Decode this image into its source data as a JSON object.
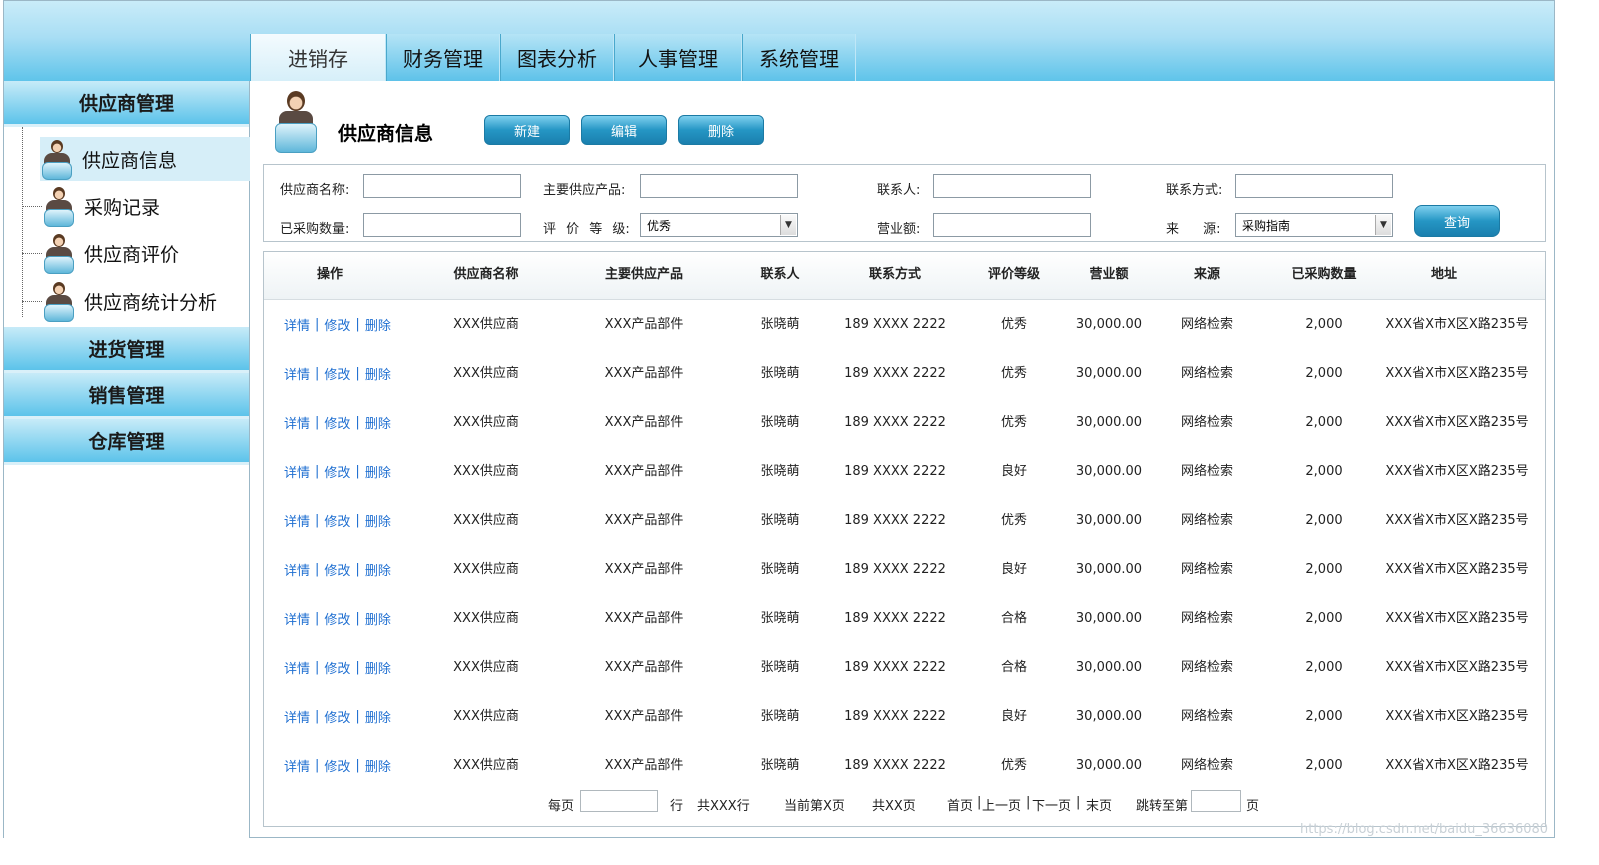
{
  "nav": {
    "tabs": [
      {
        "label": "进销存",
        "active": true
      },
      {
        "label": "财务管理"
      },
      {
        "label": "图表分析"
      },
      {
        "label": "人事管理"
      },
      {
        "label": "系统管理"
      }
    ]
  },
  "sidebar": {
    "group1": "供应商管理",
    "items": [
      {
        "label": "供应商信息",
        "icon": "supplier-person-icon",
        "active": true
      },
      {
        "label": "采购记录",
        "icon": "supplier-person-icon"
      },
      {
        "label": "供应商评价",
        "icon": "supplier-person-icon"
      },
      {
        "label": "供应商统计分析",
        "icon": "supplier-person-icon"
      }
    ],
    "group2": "进货管理",
    "group3": "销售管理",
    "group4": "仓库管理"
  },
  "main": {
    "title": "供应商信息",
    "buttons": {
      "new": "新建",
      "edit": "编辑",
      "delete": "删除"
    }
  },
  "search": {
    "name_label": "供应商名称:",
    "product_label": "主要供应产品:",
    "contact_label": "联系人:",
    "phone_label": "联系方式:",
    "qty_label": "已采购数量:",
    "rating_label": "评 价 等 级:",
    "revenue_label": "营业额:",
    "source_label": "来 源:",
    "rating_value": "优秀",
    "source_value": "采购指南",
    "query_button": "查询"
  },
  "table": {
    "headers": [
      "操作",
      "供应商名称",
      "主要供应产品",
      "联系人",
      "联系方式",
      "评价等级",
      "营业额",
      "来源",
      "已采购数量",
      "地址"
    ],
    "ops": {
      "detail": "详情",
      "modify": "修改",
      "delete": "删除",
      "sep": "|"
    },
    "rows": [
      [
        "XXX供应商",
        "XXX产品部件",
        "张晓萌",
        "189 XXXX 2222",
        "优秀",
        "30,000.00",
        "网络检索",
        "2,000",
        "XXX省X市X区X路235号"
      ],
      [
        "XXX供应商",
        "XXX产品部件",
        "张晓萌",
        "189 XXXX 2222",
        "优秀",
        "30,000.00",
        "网络检索",
        "2,000",
        "XXX省X市X区X路235号"
      ],
      [
        "XXX供应商",
        "XXX产品部件",
        "张晓萌",
        "189 XXXX 2222",
        "优秀",
        "30,000.00",
        "网络检索",
        "2,000",
        "XXX省X市X区X路235号"
      ],
      [
        "XXX供应商",
        "XXX产品部件",
        "张晓萌",
        "189 XXXX 2222",
        "良好",
        "30,000.00",
        "网络检索",
        "2,000",
        "XXX省X市X区X路235号"
      ],
      [
        "XXX供应商",
        "XXX产品部件",
        "张晓萌",
        "189 XXXX 2222",
        "优秀",
        "30,000.00",
        "网络检索",
        "2,000",
        "XXX省X市X区X路235号"
      ],
      [
        "XXX供应商",
        "XXX产品部件",
        "张晓萌",
        "189 XXXX 2222",
        "良好",
        "30,000.00",
        "网络检索",
        "2,000",
        "XXX省X市X区X路235号"
      ],
      [
        "XXX供应商",
        "XXX产品部件",
        "张晓萌",
        "189 XXXX 2222",
        "合格",
        "30,000.00",
        "网络检索",
        "2,000",
        "XXX省X市X区X路235号"
      ],
      [
        "XXX供应商",
        "XXX产品部件",
        "张晓萌",
        "189 XXXX 2222",
        "合格",
        "30,000.00",
        "网络检索",
        "2,000",
        "XXX省X市X区X路235号"
      ],
      [
        "XXX供应商",
        "XXX产品部件",
        "张晓萌",
        "189 XXXX 2222",
        "良好",
        "30,000.00",
        "网络检索",
        "2,000",
        "XXX省X市X区X路235号"
      ],
      [
        "XXX供应商",
        "XXX产品部件",
        "张晓萌",
        "189 XXXX 2222",
        "优秀",
        "30,000.00",
        "网络检索",
        "2,000",
        "XXX省X市X区X路235号"
      ]
    ]
  },
  "pager": {
    "per_page": "每页",
    "rows_unit": "行",
    "total_rows": "共XXX行",
    "current": "当前第X页",
    "total_pages": "共XX页",
    "first": "首页",
    "prev": "上一页",
    "next": "下一页",
    "last": "末页",
    "sep": "|",
    "jump": "跳转至第",
    "page_unit": "页"
  },
  "watermark": "https://blog.csdn.net/baidu_36636080",
  "colors": {
    "accent": "#2596c4",
    "link": "#1f6fd1",
    "header_bar": "#5fc4ea"
  }
}
